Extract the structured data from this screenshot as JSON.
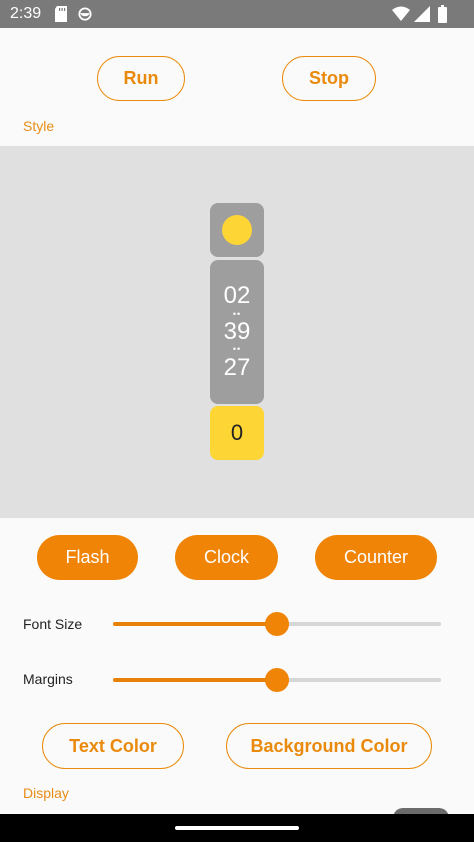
{
  "status_bar": {
    "time": "2:39",
    "icons": [
      "sd-card-icon",
      "app-circle-icon",
      "wifi-icon",
      "signal-icon",
      "battery-icon"
    ]
  },
  "controls": {
    "run_label": "Run",
    "stop_label": "Stop"
  },
  "sections": {
    "style_label": "Style",
    "display_label": "Display"
  },
  "preview": {
    "clock": {
      "hours": "02",
      "minutes": "39",
      "seconds": "27"
    },
    "counter_value": "0",
    "flash_color": "#fdd535",
    "background_color": "#e0e0e0",
    "box_color": "#9e9e9e"
  },
  "modes": {
    "flash_label": "Flash",
    "clock_label": "Clock",
    "counter_label": "Counter"
  },
  "sliders": {
    "font_size": {
      "label": "Font Size",
      "value_fraction": 0.5
    },
    "margins": {
      "label": "Margins",
      "value_fraction": 0.5
    }
  },
  "color_buttons": {
    "text_color_label": "Text Color",
    "background_color_label": "Background Color"
  },
  "theme": {
    "accent": "#ef8406",
    "status_bar_bg": "#7a7a7a"
  }
}
